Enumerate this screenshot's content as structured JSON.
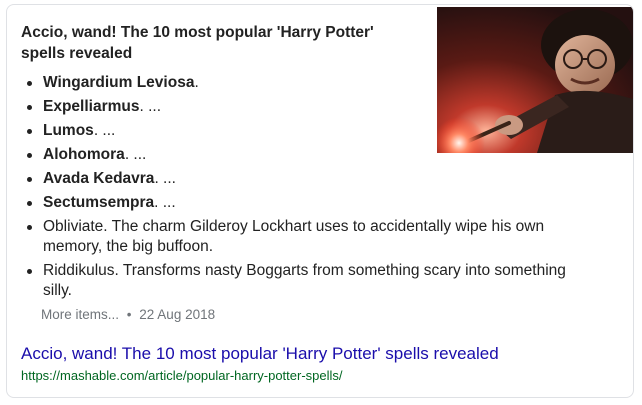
{
  "snippet": {
    "title": "Accio, wand! The 10 most popular 'Harry Potter' spells revealed",
    "items": [
      {
        "bold": "Wingardium Leviosa",
        "rest": "."
      },
      {
        "bold": "Expelliarmus",
        "rest": ". ..."
      },
      {
        "bold": "Lumos",
        "rest": ". ..."
      },
      {
        "bold": "Alohomora",
        "rest": ". ..."
      },
      {
        "bold": "Avada Kedavra",
        "rest": ". ..."
      },
      {
        "bold": "Sectumsempra",
        "rest": ". ..."
      },
      {
        "bold": "",
        "rest": "Obliviate. The charm Gilderoy Lockhart uses to accidentally wipe his own memory, the big buffoon."
      },
      {
        "bold": "",
        "rest": "Riddikulus. Transforms nasty Boggarts from something scary into something silly."
      }
    ],
    "more_items": "More items...",
    "separator": "•",
    "date": "22 Aug 2018"
  },
  "result": {
    "title": "Accio, wand! The 10 most popular 'Harry Potter' spells revealed",
    "url": "https://mashable.com/article/popular-harry-potter-spells/"
  },
  "colors": {
    "link": "#1a0dab",
    "url": "#006621",
    "meta": "#70757a",
    "text": "#222222"
  }
}
